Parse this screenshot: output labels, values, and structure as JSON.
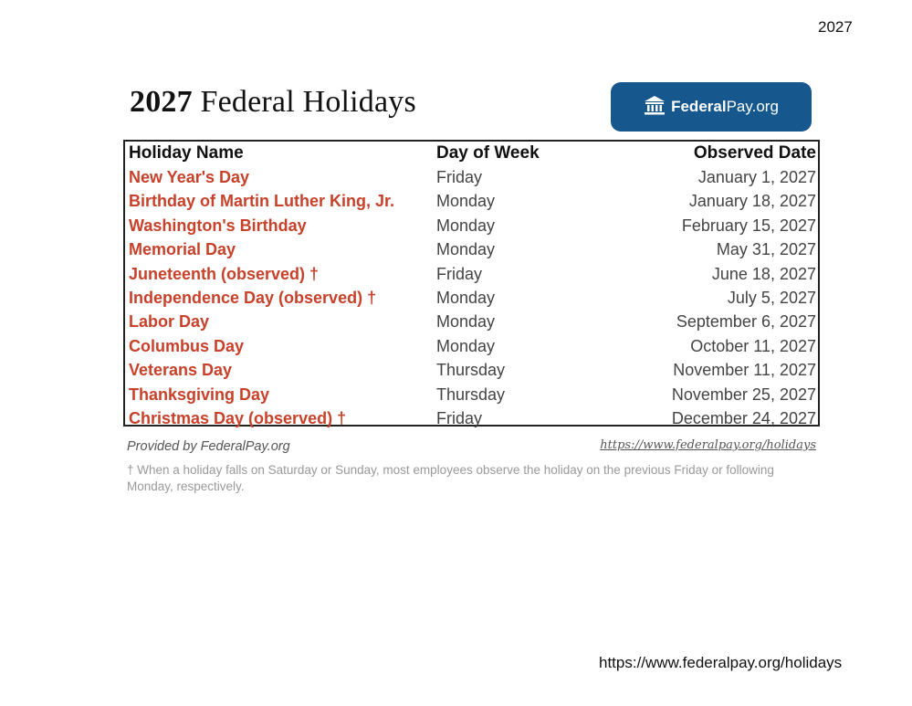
{
  "page": {
    "corner_year": "2027",
    "bottom_url": "https://www.federalpay.org/holidays"
  },
  "header": {
    "title_year": "2027",
    "title_text": "Federal Holidays",
    "logo": {
      "icon": "courthouse-icon",
      "text_bold": "Federal",
      "text_regular": "Pay.org",
      "bg_color": "#16578e"
    }
  },
  "table": {
    "columns": [
      "Holiday Name",
      "Day of Week",
      "Observed Date"
    ],
    "rows": [
      {
        "name": "New Year's Day",
        "day": "Friday",
        "date": "January 1, 2027"
      },
      {
        "name": "Birthday of Martin Luther King, Jr.",
        "day": "Monday",
        "date": "January 18, 2027"
      },
      {
        "name": "Washington's Birthday",
        "day": "Monday",
        "date": "February 15, 2027"
      },
      {
        "name": "Memorial Day",
        "day": "Monday",
        "date": "May 31, 2027"
      },
      {
        "name": "Juneteenth (observed) †",
        "day": "Friday",
        "date": "June 18, 2027"
      },
      {
        "name": "Independence Day (observed) †",
        "day": "Monday",
        "date": "July 5, 2027"
      },
      {
        "name": "Labor Day",
        "day": "Monday",
        "date": "September 6, 2027"
      },
      {
        "name": "Columbus Day",
        "day": "Monday",
        "date": "October 11, 2027"
      },
      {
        "name": "Veterans Day",
        "day": "Thursday",
        "date": "November 11, 2027"
      },
      {
        "name": "Thanksgiving Day",
        "day": "Thursday",
        "date": "November 25, 2027"
      },
      {
        "name": "Christmas Day (observed) †",
        "day": "Friday",
        "date": "December 24, 2027"
      }
    ],
    "name_color": "#c8412a"
  },
  "footer": {
    "provided_by": "Provided by FederalPay.org",
    "source_link": "https://www.federalpay.org/holidays",
    "footnote": "† When a holiday falls on Saturday or Sunday, most employees observe the holiday on the previous Friday or following Monday, respectively."
  }
}
